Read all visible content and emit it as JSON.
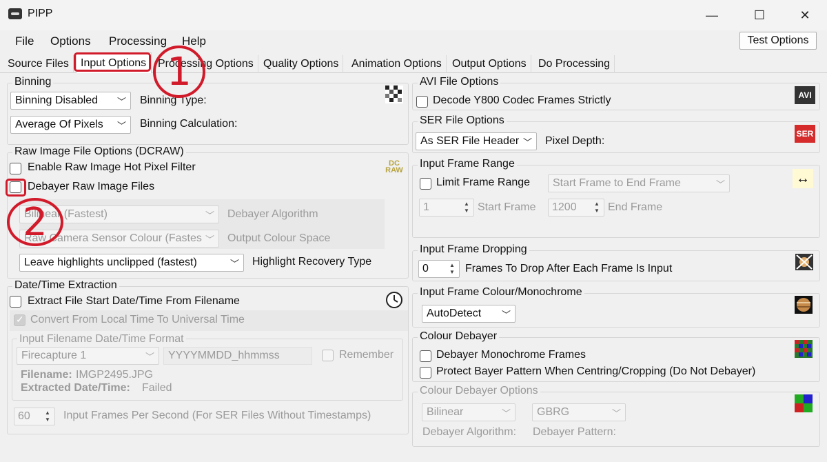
{
  "window": {
    "title": "PIPP",
    "minimize": "—",
    "maximize": "☐",
    "close": "✕"
  },
  "menu": {
    "file": "File",
    "options": "Options",
    "processing": "Processing",
    "help": "Help",
    "test_options": "Test Options"
  },
  "tabs": [
    "Source Files",
    "Input Options",
    "Processing Options",
    "Quality Options",
    "Animation Options",
    "Output Options",
    "Do Processing"
  ],
  "binning": {
    "legend": "Binning",
    "type_value": "Binning Disabled",
    "type_label": "Binning Type:",
    "calc_value": "Average Of Pixels",
    "calc_label": "Binning Calculation:"
  },
  "raw": {
    "legend": "Raw Image File Options (DCRAW)",
    "hot_pixel": "Enable Raw Image Hot Pixel Filter",
    "debayer": "Debayer Raw Image Files",
    "algorithm_value": "Bilinear (Fastest)",
    "algorithm_label": "Debayer Algorithm",
    "colour_value": "Raw Camera Sensor Colour (Fastes",
    "colour_label": "Output Colour Space",
    "highlight_value": "Leave highlights unclipped (fastest)",
    "highlight_label": "Highlight Recovery Type",
    "icon_text": "DC RAW"
  },
  "datetime": {
    "legend": "Date/Time Extraction",
    "extract": "Extract File Start Date/Time From Filename",
    "convert": "Convert From Local Time To Universal Time",
    "format_legend": "Input Filename Date/Time Format",
    "format_value": "Firecapture 1",
    "format_pattern": "YYYYMMDD_hhmmss",
    "remember": "Remember",
    "filename_label": "Filename:",
    "filename_value": "IMGP2495.JPG",
    "extracted_label": "Extracted Date/Time:",
    "extracted_value": "Failed",
    "fps_value": "60",
    "fps_label": "Input Frames Per Second (For SER Files Without Timestamps)"
  },
  "avi": {
    "legend": "AVI File Options",
    "decode": "Decode Y800 Codec Frames Strictly",
    "icon_text": "AVI"
  },
  "ser": {
    "legend": "SER File Options",
    "depth_value": "As SER File Header",
    "depth_label": "Pixel Depth:",
    "icon_text": "SER"
  },
  "range": {
    "legend": "Input Frame Range",
    "limit": "Limit Frame Range",
    "mode_value": "Start Frame to End Frame",
    "start_value": "1",
    "start_label": "Start Frame",
    "end_value": "1200",
    "end_label": "End Frame"
  },
  "dropping": {
    "legend": "Input Frame Dropping",
    "value": "0",
    "label": "Frames To Drop After Each Frame Is Input"
  },
  "colour_mono": {
    "legend": "Input Frame Colour/Monochrome",
    "value": "AutoDetect"
  },
  "colour_debayer": {
    "legend": "Colour Debayer",
    "mono": "Debayer Monochrome Frames",
    "protect": "Protect Bayer Pattern When Centring/Cropping (Do Not Debayer)"
  },
  "debayer_opts": {
    "legend": "Colour Debayer Options",
    "algorithm_value": "Bilinear",
    "algorithm_label": "Debayer Algorithm:",
    "pattern_value": "GBRG",
    "pattern_label": "Debayer Pattern:"
  },
  "annotations": {
    "one": "1",
    "two": "2"
  },
  "colors": {
    "annotation": "#d11a2a"
  }
}
